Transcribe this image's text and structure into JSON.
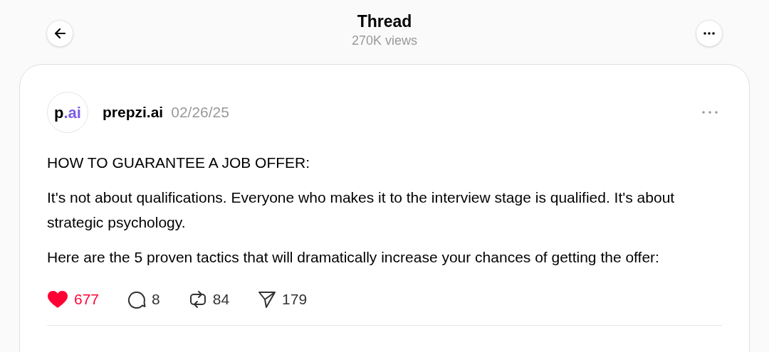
{
  "header": {
    "title": "Thread",
    "subtitle": "270K views"
  },
  "post": {
    "avatar": {
      "main": "p",
      "accent": ".ai"
    },
    "author": "prepzi.ai",
    "date": "02/26/25",
    "paragraphs": [
      "HOW TO GUARANTEE A JOB OFFER:",
      "It's not about qualifications. Everyone who makes it to the interview stage is qualified. It's about strategic psychology.",
      "Here are the 5 proven tactics that will dramatically increase your chances of getting the offer:"
    ],
    "actions": [
      {
        "kind": "like",
        "count": "677",
        "selected": true
      },
      {
        "kind": "comment",
        "count": "8",
        "selected": false
      },
      {
        "kind": "repost",
        "count": "84",
        "selected": false
      },
      {
        "kind": "share",
        "count": "179",
        "selected": false
      }
    ]
  }
}
